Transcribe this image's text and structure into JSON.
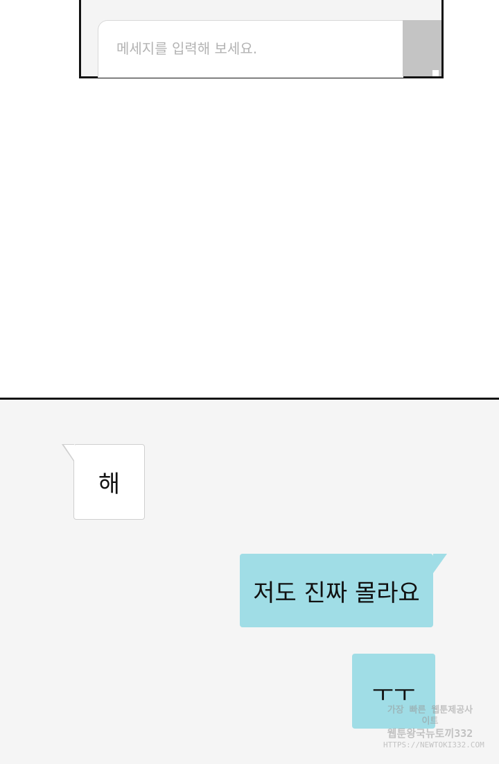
{
  "input_bar": {
    "placeholder": "메세지를 입력해 보세요."
  },
  "messages": [
    {
      "side": "received",
      "text": "해"
    },
    {
      "side": "sent",
      "text": "저도 진짜 몰라요"
    },
    {
      "side": "sent",
      "text": "ㅜㅜ"
    }
  ],
  "watermark": {
    "line1": "가장 빠른 웹툰제공사이트",
    "line2": "웹툰왕국뉴토끼332",
    "line3": "HTTPS://NEWTOKI332.COM"
  },
  "colors": {
    "sent_bubble": "#a0dde6",
    "received_bubble": "#ffffff",
    "chat_background": "#f5f5f5"
  }
}
